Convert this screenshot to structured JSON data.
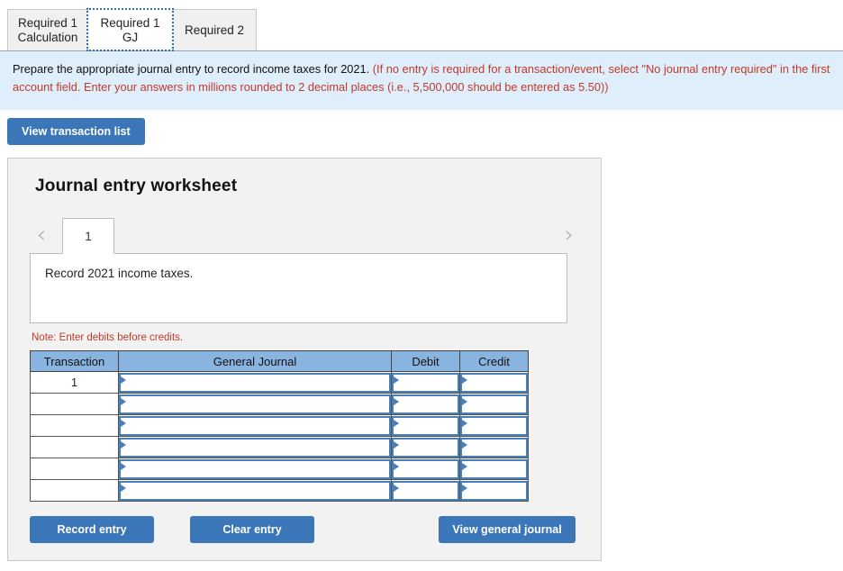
{
  "tabs": [
    {
      "label": "Required 1\nCalculation",
      "active": false,
      "name": "tab-required-1-calculation"
    },
    {
      "label": "Required 1 GJ",
      "active": true,
      "name": "tab-required-1-gj"
    },
    {
      "label": "Required 2",
      "active": false,
      "name": "tab-required-2"
    }
  ],
  "instructions": {
    "black_part": "Prepare the appropriate journal entry to record income taxes for 2021. ",
    "red_part": "(If no entry is required for a transaction/event, select \"No journal entry required\" in the first account field. Enter your answers in millions rounded to 2 decimal places (i.e., 5,500,000 should be entered as 5.50))"
  },
  "toolbar": {
    "view_transaction_list_label": "View transaction list"
  },
  "worksheet": {
    "title": "Journal entry worksheet",
    "prev_icon": "‹",
    "next_icon": "›",
    "current_sheet": "1",
    "description": "Record 2021 income taxes.",
    "note": "Note: Enter debits before credits."
  },
  "table": {
    "headers": [
      "Transaction",
      "General Journal",
      "Debit",
      "Credit"
    ],
    "rows": [
      {
        "transaction": "1",
        "general_journal": "",
        "debit": "",
        "credit": ""
      },
      {
        "transaction": "",
        "general_journal": "",
        "debit": "",
        "credit": ""
      },
      {
        "transaction": "",
        "general_journal": "",
        "debit": "",
        "credit": ""
      },
      {
        "transaction": "",
        "general_journal": "",
        "debit": "",
        "credit": ""
      },
      {
        "transaction": "",
        "general_journal": "",
        "debit": "",
        "credit": ""
      },
      {
        "transaction": "",
        "general_journal": "",
        "debit": "",
        "credit": ""
      }
    ]
  },
  "footer": {
    "record_entry_label": "Record entry",
    "clear_entry_label": "Clear entry",
    "view_general_journal_label": "View general journal"
  },
  "colors": {
    "accent_blue": "#3a76b8",
    "table_header_blue": "#8ab4e0",
    "input_border_blue": "#4a7fb5",
    "instruction_bg": "#dfeefb",
    "warning_red": "#c0392b",
    "panel_bg": "#f2f2f2"
  }
}
